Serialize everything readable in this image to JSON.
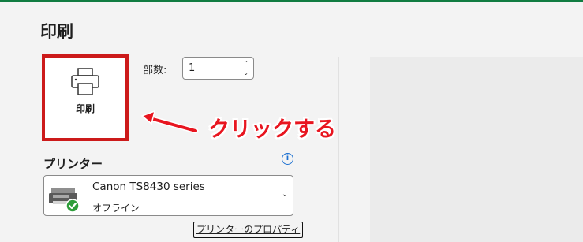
{
  "page": {
    "title": "印刷"
  },
  "print_button": {
    "label": "印刷"
  },
  "copies": {
    "label": "部数:",
    "value": "1"
  },
  "annotation": {
    "text": "クリックする",
    "color": "#e8151f"
  },
  "printer": {
    "heading": "プリンター",
    "name": "Canon TS8430 series",
    "status": "オフライン",
    "properties_link": "プリンターのプロパティ"
  },
  "colors": {
    "accent": "#107c41",
    "highlight_border": "#cc1a1a",
    "info": "#1a6fd1"
  }
}
